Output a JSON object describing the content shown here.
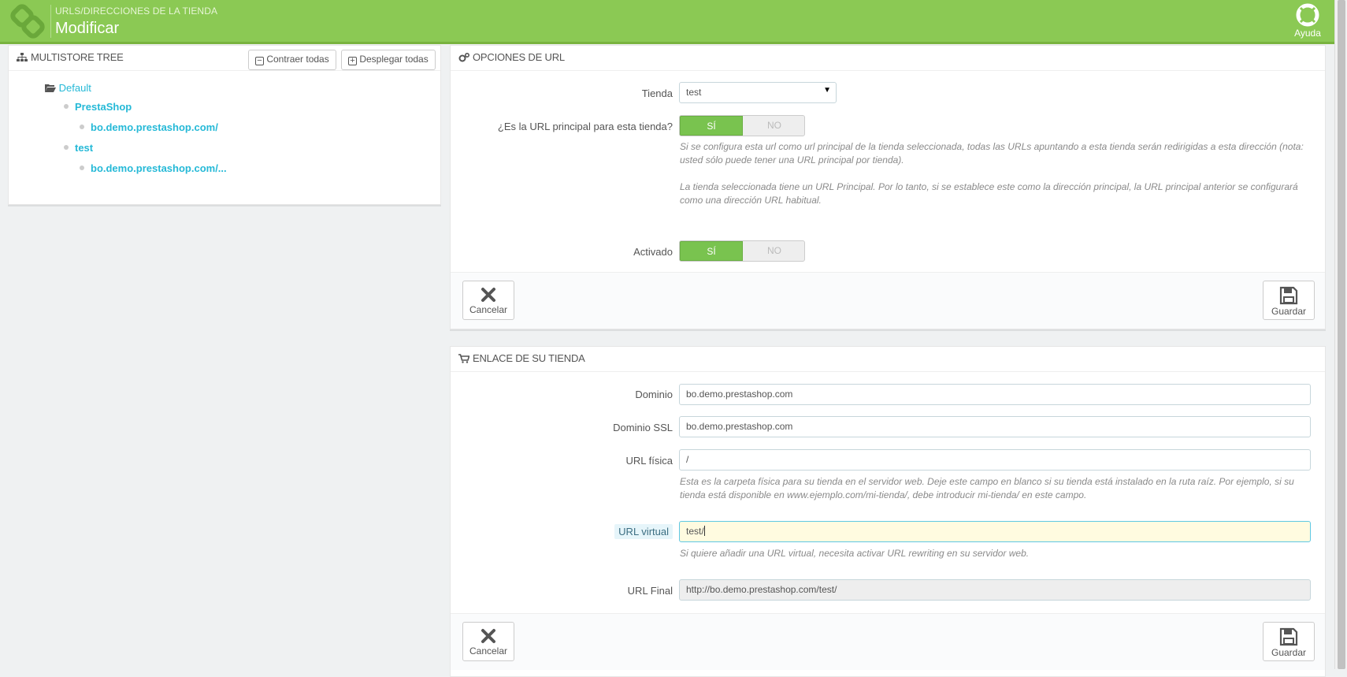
{
  "header": {
    "breadcrumb": "URLS/DIRECCIONES DE LA TIENDA",
    "title": "Modificar",
    "help_label": "Ayuda",
    "accent": "#8bc954"
  },
  "tree": {
    "heading": "MULTISTORE TREE",
    "collapse_label": "Contraer todas",
    "expand_label": "Desplegar todas",
    "group": "Default",
    "shops": [
      {
        "name": "PrestaShop",
        "url": "bo.demo.prestashop.com/"
      },
      {
        "name": "test",
        "url": "bo.demo.prestashop.com/..."
      }
    ]
  },
  "url_options": {
    "heading": "OPCIONES DE URL",
    "shop_label": "Tienda",
    "shop_value": "test",
    "main_url_label": "¿Es la URL principal para esta tienda?",
    "yes": "SÍ",
    "no": "NO",
    "main_url_help_1": "Si se configura esta url como url principal de la tienda seleccionada, todas las URLs apuntando a esta tienda serán redirigidas a esta dirección (nota: usted sólo puede tener una URL principal por tienda).",
    "main_url_help_2": "La tienda seleccionada tiene un URL Principal. Por lo tanto, si se establece este como la dirección principal, la URL principal anterior se configurará como una dirección URL habitual.",
    "enabled_label": "Activado",
    "cancel_label": "Cancelar",
    "save_label": "Guardar"
  },
  "shop_link": {
    "heading": "ENLACE DE SU TIENDA",
    "domain_label": "Dominio",
    "domain_value": "bo.demo.prestashop.com",
    "ssl_label": "Dominio SSL",
    "ssl_value": "bo.demo.prestashop.com",
    "physical_label": "URL física",
    "physical_value": "/",
    "physical_help": "Esta es la carpeta física para su tienda en el servidor web. Deje este campo en blanco si su tienda está instalado en la ruta raíz. Por ejemplo, si su tienda está disponible en www.ejemplo.com/mi-tienda/, debe introducir mi-tienda/ en este campo.",
    "virtual_label": "URL virtual",
    "virtual_value": "test/",
    "virtual_help": "Si quiere añadir una URL virtual, necesita activar URL rewriting en su servidor web.",
    "final_label": "URL Final",
    "final_value": "http://bo.demo.prestashop.com/test/",
    "cancel_label": "Cancelar",
    "save_label": "Guardar"
  }
}
